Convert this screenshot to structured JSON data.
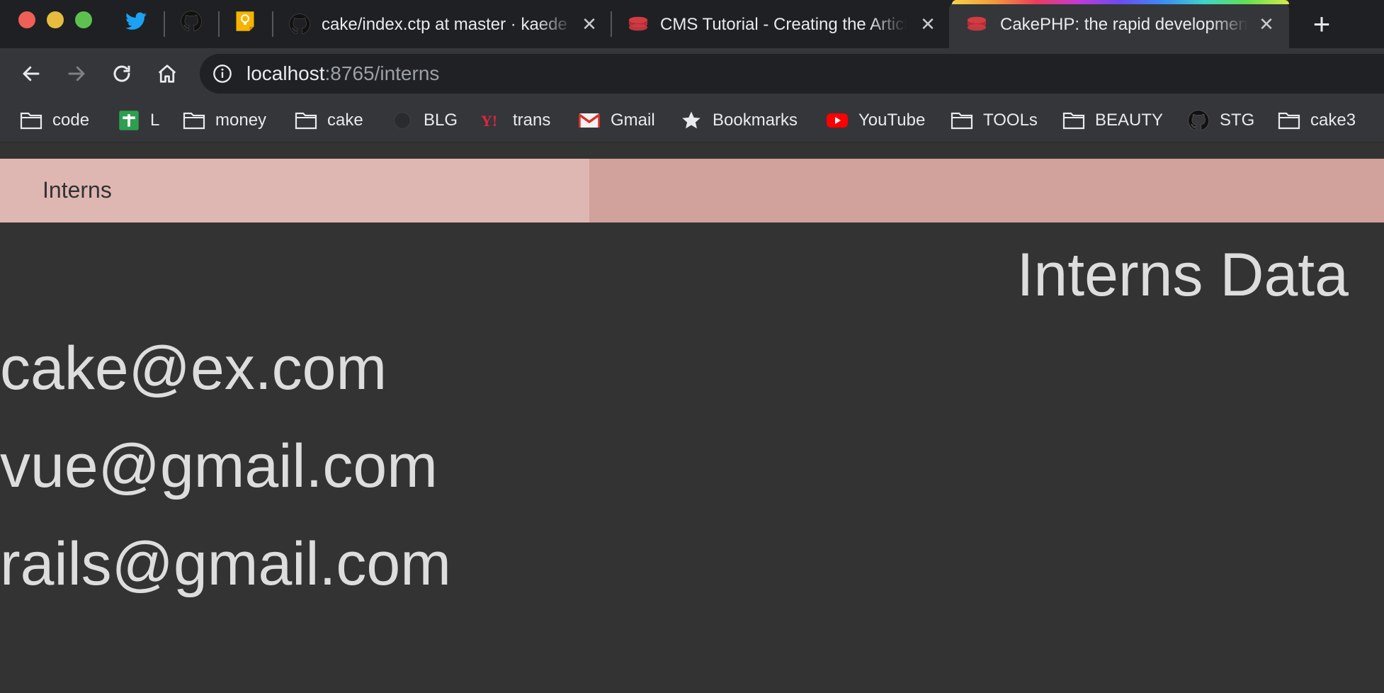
{
  "browser": {
    "tabs": [
      {
        "title": "cake/index.ctp at master · kaede",
        "favicon": "github-icon"
      },
      {
        "title": "CMS Tutorial - Creating the Articles",
        "favicon": "cakephp-icon"
      },
      {
        "title": "CakePHP: the rapid development",
        "favicon": "cakephp-icon",
        "active": true
      }
    ],
    "pinned_tabs": [
      "twitter-icon",
      "github-icon",
      "keep-icon"
    ],
    "url": {
      "host": "localhost",
      "rest": ":8765/interns"
    },
    "bookmarks": [
      {
        "label": "code",
        "icon": "folder-icon"
      },
      {
        "label": "L",
        "icon": "plus-square-icon"
      },
      {
        "label": "money",
        "icon": "folder-icon"
      },
      {
        "label": "cake",
        "icon": "folder-icon"
      },
      {
        "label": "BLG",
        "icon": "globe-icon"
      },
      {
        "label": "trans",
        "icon": "yahoo-icon"
      },
      {
        "label": "Gmail",
        "icon": "gmail-icon"
      },
      {
        "label": "Bookmarks",
        "icon": "star-icon"
      },
      {
        "label": "YouTube",
        "icon": "youtube-icon"
      },
      {
        "label": "TOOLs",
        "icon": "folder-icon"
      },
      {
        "label": "BEAUTY",
        "icon": "folder-icon"
      },
      {
        "label": "STG",
        "icon": "github-icon"
      },
      {
        "label": "cake3",
        "icon": "folder-icon"
      }
    ]
  },
  "page": {
    "nav_title": "Interns",
    "heading": "Interns Data",
    "emails": [
      "cake@ex.com",
      "vue@gmail.com",
      "rails@gmail.com"
    ]
  },
  "colors": {
    "navbar_title_bg": "#dfb7b2",
    "navbar_bg": "#d1a19c",
    "page_bg": "#333333",
    "text": "#dddddd"
  }
}
